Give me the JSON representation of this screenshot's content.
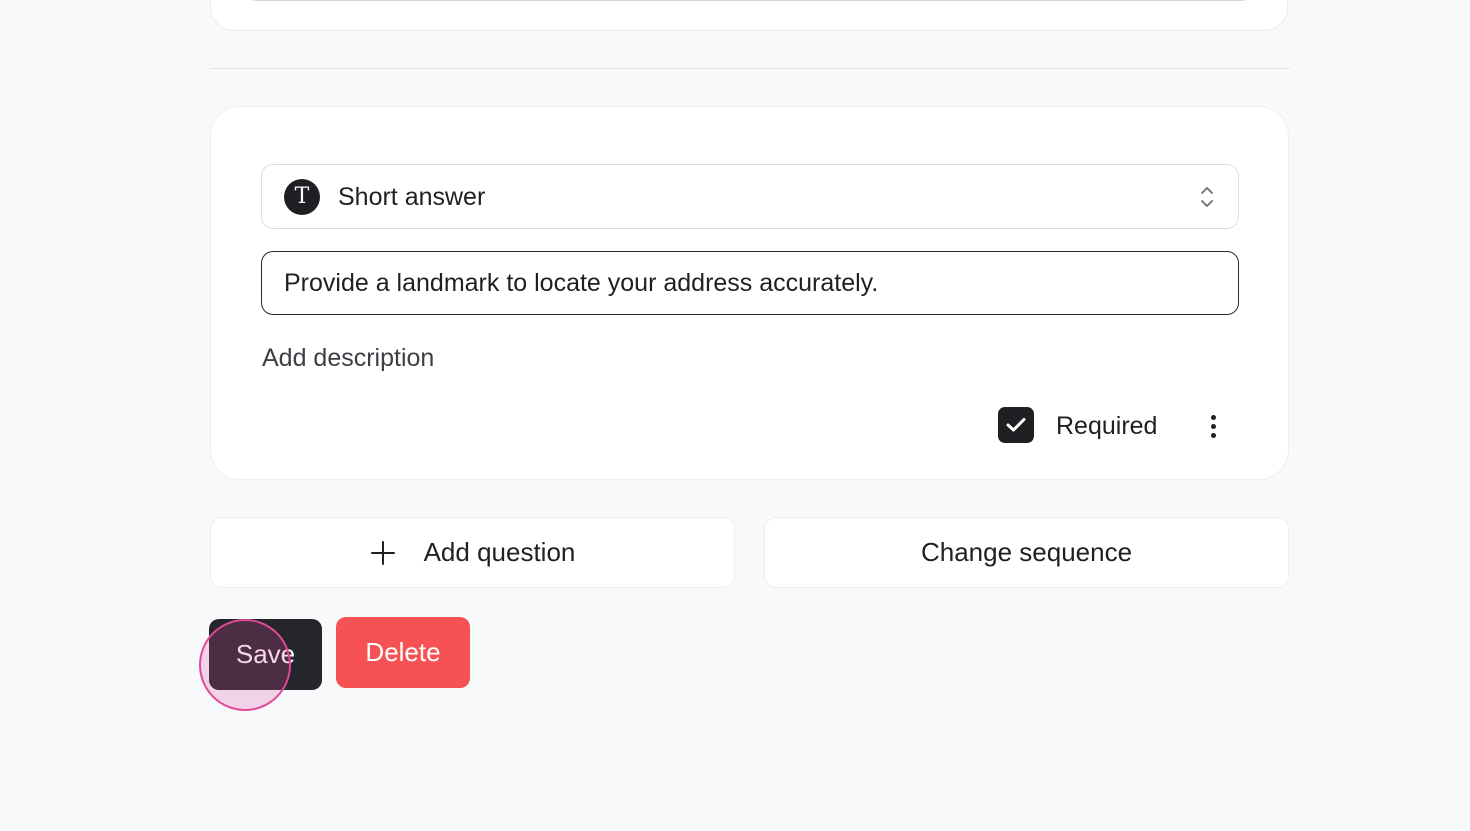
{
  "question": {
    "type_label": "Short answer",
    "type_icon_letter": "T",
    "text_value": "Provide a landmark to locate your address accurately.",
    "add_description_label": "Add description",
    "required_label": "Required",
    "required_checked": true
  },
  "actions": {
    "add_question_label": "Add question",
    "change_sequence_label": "Change sequence"
  },
  "footer": {
    "save_label": "Save",
    "delete_label": "Delete"
  },
  "colors": {
    "background": "#f8f9fb",
    "primary_dark": "#25262b",
    "danger": "#f65253",
    "click_indicator": "#e0489a"
  }
}
